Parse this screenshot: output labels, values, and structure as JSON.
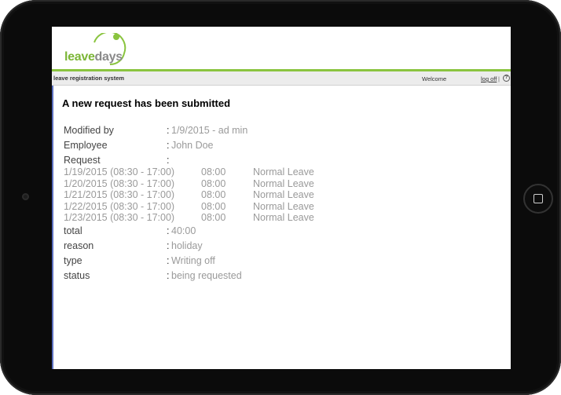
{
  "app": {
    "logo": {
      "part1": "leave",
      "part2": "days"
    },
    "subbar": {
      "system_name": "leave registration system",
      "welcome": "Welcome",
      "logoff": "log off",
      "separator": "|"
    }
  },
  "main": {
    "title": "A new request has been submitted",
    "fields_top": [
      {
        "label": "Modified by",
        "value": "1/9/2015 - ad min"
      },
      {
        "label": "Employee",
        "value": "John Doe"
      },
      {
        "label": "Request",
        "value": ""
      }
    ],
    "request_rows": [
      {
        "date": "1/19/2015 (08:30 - 17:00)",
        "hours": "08:00",
        "type": "Normal Leave"
      },
      {
        "date": "1/20/2015 (08:30 - 17:00)",
        "hours": "08:00",
        "type": "Normal Leave"
      },
      {
        "date": "1/21/2015 (08:30 - 17:00)",
        "hours": "08:00",
        "type": "Normal Leave"
      },
      {
        "date": "1/22/2015 (08:30 - 17:00)",
        "hours": "08:00",
        "type": "Normal Leave"
      },
      {
        "date": "1/23/2015 (08:30 - 17:00)",
        "hours": "08:00",
        "type": "Normal Leave"
      }
    ],
    "fields_bottom": [
      {
        "label": "total",
        "value": "40:00"
      },
      {
        "label": "reason",
        "value": "holiday"
      },
      {
        "label": "type",
        "value": "Writing off"
      },
      {
        "label": "status",
        "value": "being requested"
      }
    ],
    "colon": ":"
  },
  "colors": {
    "brand_green": "#8ac43f",
    "value_gray": "#9a9a9a"
  },
  "icons": {
    "help": "help-icon",
    "home": "home-button-icon",
    "camera": "camera-icon"
  }
}
